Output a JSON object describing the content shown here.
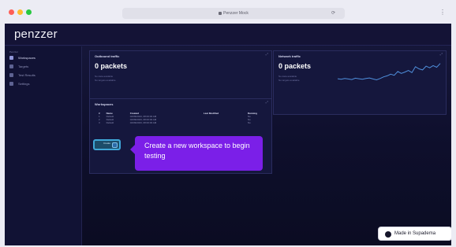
{
  "browser": {
    "url_text": "Penzzer Mock",
    "url_icon": "refresh-icon",
    "extra_icon": "extensions-icon"
  },
  "app": {
    "logo": "penzzer"
  },
  "sidebar": {
    "heading": "Penzzer",
    "items": [
      {
        "label": "Workspaces",
        "icon": "workspace-icon",
        "active": true
      },
      {
        "label": "Targets",
        "icon": "target-icon",
        "active": false
      },
      {
        "label": "Test Results",
        "icon": "results-icon",
        "active": false
      },
      {
        "label": "Settings",
        "icon": "settings-icon",
        "active": false
      }
    ]
  },
  "panels": {
    "outbound": {
      "title": "Outbound traffic",
      "value": "0 packets",
      "line1": "No data available",
      "line2": "No targets available"
    },
    "network": {
      "title": "Network traffic",
      "value": "0 packets",
      "line1": "No data available",
      "line2": "No targets available"
    },
    "workspaces": {
      "title": "Workspaces",
      "columns": [
        "#",
        "Name",
        "Created",
        "Last Modified",
        "Running"
      ],
      "rows": [
        [
          "1",
          "Default",
          "02/09/2023, 08:00:00 AM",
          "",
          "No"
        ],
        [
          "2",
          "Default",
          "02/09/2023, 08:00:00 AM",
          "",
          "No"
        ],
        [
          "3",
          "Default",
          "02/09/2023, 08:00:00 AM",
          "",
          "No"
        ]
      ]
    }
  },
  "create_button": {
    "label": "Create"
  },
  "tooltip": {
    "text": "Create a new workspace to begin testing"
  },
  "made_badge": {
    "label": "Made in Supadema"
  },
  "network_chart": {
    "values": [
      0.35,
      0.33,
      0.36,
      0.34,
      0.32,
      0.37,
      0.35,
      0.33,
      0.36,
      0.38,
      0.34,
      0.31,
      0.36,
      0.42,
      0.46,
      0.52,
      0.48,
      0.62,
      0.55,
      0.6,
      0.66,
      0.58,
      0.8,
      0.72,
      0.68,
      0.82,
      0.76,
      0.84,
      0.78,
      0.92
    ]
  },
  "colors": {
    "accent": "#7b1fe8",
    "app_bg": "#111234",
    "chart_line": "#4f8fdc"
  }
}
